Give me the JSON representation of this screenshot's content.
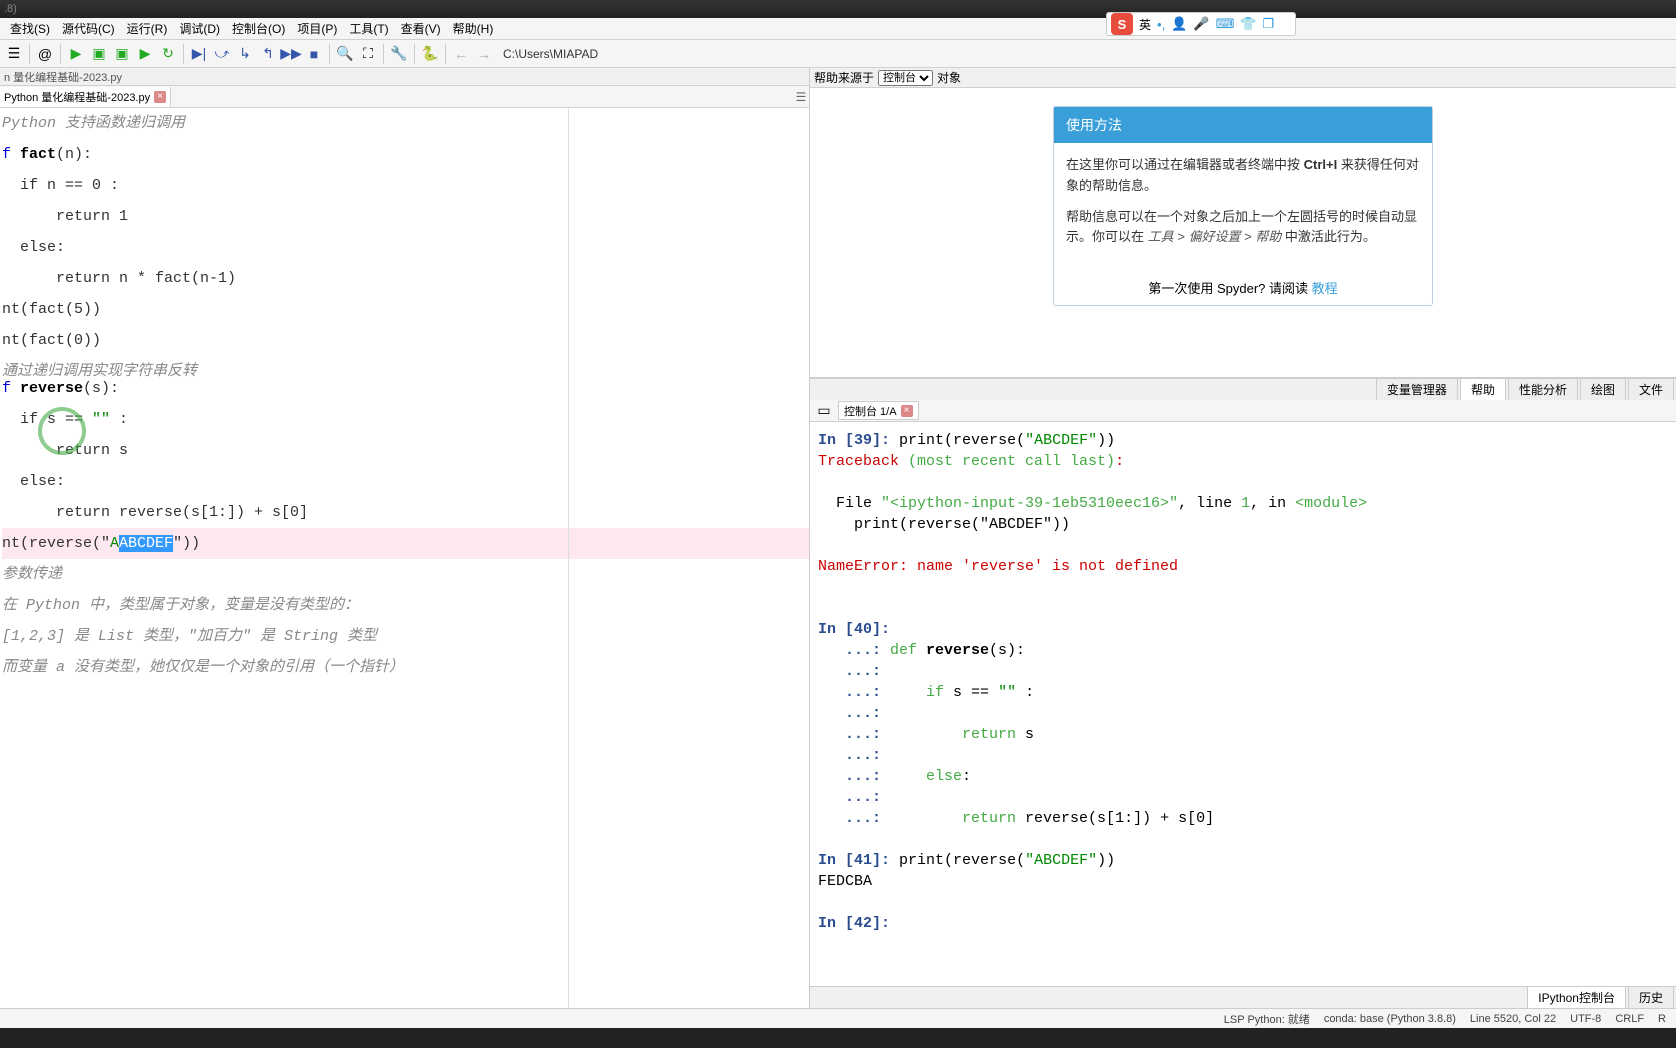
{
  "title": ".8)",
  "menu": [
    "查找(S)",
    "源代码(C)",
    "运行(R)",
    "调试(D)",
    "控制台(O)",
    "项目(P)",
    "工具(T)",
    "查看(V)",
    "帮助(H)"
  ],
  "path": "C:\\Users\\MIAPAD",
  "breadcrumb": "n 量化编程基础-2023.py",
  "editor_tab": "Python 量化编程基础-2023.py",
  "help_header": {
    "label": "帮助来源于",
    "select": "控制台",
    "obj": "对象"
  },
  "help_card": {
    "title": "使用方法",
    "p1_a": "在这里你可以通过在编辑器或者终端中按 ",
    "p1_b": "Ctrl+I",
    "p1_c": " 来获得任何对象的帮助信息。",
    "p2_a": "帮助信息可以在一个对象之后加上一个左圆括号的时候自动显示。你可以在 ",
    "p2_b": "工具 > 偏好设置 > 帮助",
    "p2_c": " 中激活此行为。",
    "footer_a": "第一次使用 Spyder? 请阅读 ",
    "footer_link": "教程"
  },
  "right_tabs": [
    "变量管理器",
    "帮助",
    "性能分析",
    "绘图",
    "文件"
  ],
  "console_tab": "控制台 1/A",
  "bottom_tabs": [
    "IPython控制台",
    "历史"
  ],
  "editor_lines": {
    "comment_recursion": "Python 支持函数递归调用",
    "def_fact": "fact",
    "cond1": "if n == 0 :",
    "ret1": "return 1",
    "else1": "else:",
    "ret2": "return n * fact(n-1)",
    "print_fact5": "nt(fact(5))",
    "print_fact0": "nt(fact(0))",
    "comment_rev": "通过递归调用实现字符串反转",
    "def_rev": "reverse",
    "cond2": "if s == \"\" :",
    "ret3": "return s",
    "else2": "else:",
    "ret4": "return reverse(s[1:]) + s[0]",
    "print_rev_pre": "nt(reverse(\"",
    "print_rev_sel": "ABCDEF",
    "print_rev_post": "\"))",
    "comment_param": "参数传递",
    "comment_type1": "在 Python 中，类型属于对象，变量是没有类型的：",
    "comment_type2": "[1,2,3] 是 List 类型，\"加百力\" 是 String 类型",
    "comment_type3": "而变量 a 没有类型，她仅仅是一个对象的引用（一个指针）"
  },
  "console": {
    "in39": "39",
    "in39_code": "print(reverse(\"ABCDEF\"))",
    "traceback": "Traceback (most recent call last):",
    "file_line": "  File \"<ipython-input-39-1eb5310eec16>\", line 1, in <module>",
    "file_code": "    print(reverse(\"ABCDEF\"))",
    "nameerror": "NameError: name 'reverse' is not defined",
    "in40": "40",
    "def40": "reverse",
    "cond40": "if s == \"\" :",
    "ret40a": "return s",
    "else40": "else:",
    "ret40b": "return reverse(s[1:]) + s[0]",
    "in41": "41",
    "in41_code": "print(reverse(\"ABCDEF\"))",
    "out41": "FEDCBA",
    "in42": "42"
  },
  "status": {
    "lsp": "LSP Python: 就绪",
    "conda": "conda: base (Python 3.8.8)",
    "line": "Line 5520, Col 22",
    "enc": "UTF-8",
    "eol": "CRLF",
    "mode": "R"
  },
  "ime": "英"
}
